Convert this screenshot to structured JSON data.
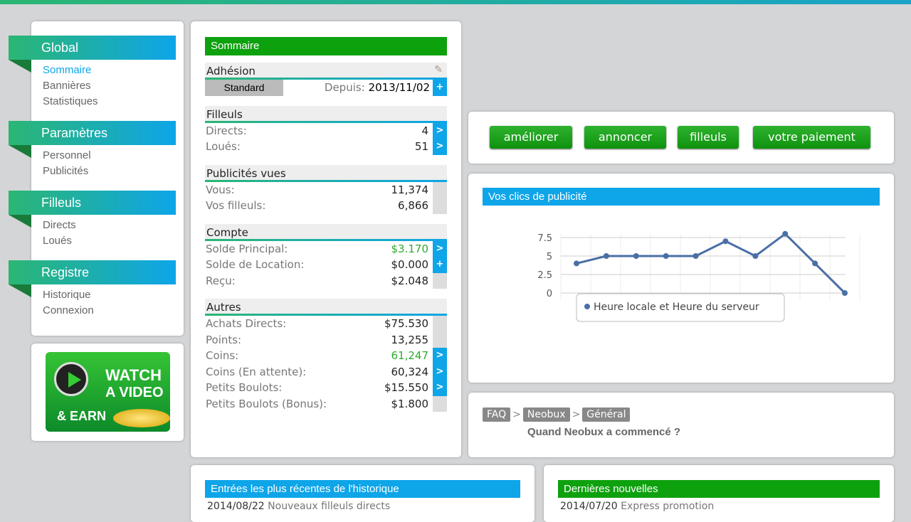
{
  "sidebar": {
    "groups": [
      {
        "title": "Global",
        "items": [
          "Sommaire",
          "Bannières",
          "Statistiques"
        ]
      },
      {
        "title": "Paramètres",
        "items": [
          "Personnel",
          "Publicités"
        ]
      },
      {
        "title": "Filleuls",
        "items": [
          "Directs",
          "Loués"
        ]
      },
      {
        "title": "Registre",
        "items": [
          "Historique",
          "Connexion"
        ]
      }
    ]
  },
  "video_banner": {
    "line1": "WATCH",
    "line2": "A VIDEO",
    "line3": "& EARN"
  },
  "summary": {
    "title": "Sommaire",
    "adhesion": {
      "title": "Adhésion",
      "level": "Standard",
      "since_label": "Depuis:",
      "since": "2013/11/02",
      "action": "+"
    },
    "filleuls": {
      "title": "Filleuls",
      "rows": [
        {
          "label": "Directs:",
          "value": "4",
          "action": ">"
        },
        {
          "label": "Loués:",
          "value": "51",
          "action": ">"
        }
      ]
    },
    "pubs": {
      "title": "Publicités vues",
      "rows": [
        {
          "label": "Vous:",
          "value": "11,374"
        },
        {
          "label": "Vos filleuls:",
          "value": "6,866"
        }
      ]
    },
    "compte": {
      "title": "Compte",
      "rows": [
        {
          "label": "Solde Principal:",
          "value": "$3.170",
          "action": ">"
        },
        {
          "label": "Solde de Location:",
          "value": "$0.000",
          "action": "+"
        },
        {
          "label": "Reçu:",
          "value": "$2.048"
        }
      ]
    },
    "autres": {
      "title": "Autres",
      "rows": [
        {
          "label": "Achats Directs:",
          "value": "$75.530"
        },
        {
          "label": "Points:",
          "value": "13,255"
        },
        {
          "label": "Coins:",
          "value": "61,247",
          "action": ">"
        },
        {
          "label": "Coins (En attente):",
          "value": "60,324",
          "action": ">"
        },
        {
          "label": "Petits Boulots:",
          "value": "$15.550",
          "action": ">"
        },
        {
          "label": "Petits Boulots (Bonus):",
          "value": "$1.800"
        }
      ]
    }
  },
  "actions": {
    "upgrade": "améliorer",
    "advertise": "annoncer",
    "referrals": "filleuls",
    "payment": "votre paiement"
  },
  "chart_data": {
    "type": "line",
    "title": "Vos clics de publicité",
    "x": [
      1,
      2,
      3,
      4,
      5,
      6,
      7,
      8,
      9,
      10
    ],
    "series": [
      {
        "name": "Heure locale et Heure du serveur",
        "values": [
          4,
          5,
          5,
          5,
          5,
          7,
          5,
          8,
          4,
          0
        ]
      }
    ],
    "yticks": [
      "0",
      "2.5",
      "5",
      "7.5"
    ],
    "ylim": [
      0,
      8
    ],
    "grid": true,
    "legend": "bottom"
  },
  "faq": {
    "crumbs": [
      "FAQ",
      "Neobux",
      "Général"
    ],
    "sep": ">",
    "question": "Quand Neobux a commencé ?"
  },
  "history": {
    "title": "Entrées les plus récentes de l'historique",
    "entries": [
      {
        "date": "2014/08/22",
        "text": "Nouveaux filleuls directs"
      }
    ]
  },
  "news": {
    "title": "Dernières nouvelles",
    "entries": [
      {
        "date": "2014/07/20",
        "text": "Express promotion"
      }
    ]
  },
  "colors": {
    "green": "#0ea10e",
    "blue": "#0ea5e9"
  }
}
